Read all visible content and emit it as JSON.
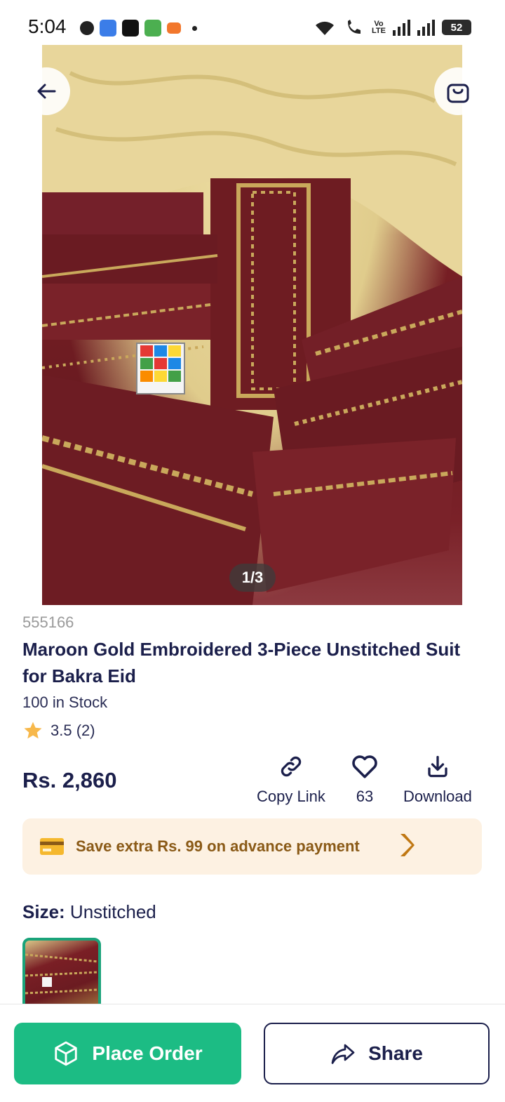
{
  "status_bar": {
    "time": "5:04",
    "lte": "Vo\nLTE",
    "battery": "52"
  },
  "gallery": {
    "pager": "1/3"
  },
  "product": {
    "sku": "555166",
    "title": "Maroon Gold Embroidered 3-Piece Unstitched Suit for Bakra Eid",
    "stock": "100 in Stock",
    "rating": "3.5 (2)",
    "price": "Rs. 2,860"
  },
  "actions": {
    "copy_link": "Copy Link",
    "likes": "63",
    "download": "Download"
  },
  "promo": {
    "text": "Save extra Rs. 99 on advance payment"
  },
  "size": {
    "label": "Size:",
    "value": " Unstitched"
  },
  "bottom_bar": {
    "place_order": "Place Order",
    "share": "Share"
  },
  "colors": {
    "brand_green": "#1cbc84",
    "navy_text": "#1b1f4b",
    "promo_bg": "#fdf1e2",
    "promo_text": "#8a5a17",
    "star": "#f7b84b"
  },
  "icons": [
    "back-arrow-icon",
    "shopping-bag-icon",
    "link-icon",
    "heart-icon",
    "download-icon",
    "credit-card-icon",
    "chevron-right-icon",
    "star-icon",
    "package-icon",
    "share-icon"
  ]
}
